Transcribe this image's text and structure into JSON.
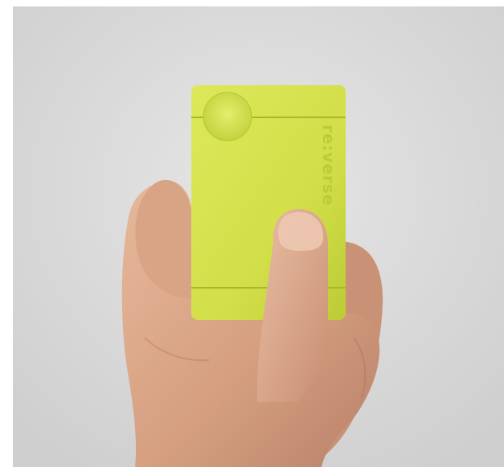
{
  "photo": {
    "subject": "product-photo-hand-holding-card-device",
    "device": {
      "brand_text": "re:verse",
      "color": "#d4e14a"
    },
    "background_color": "#d9d9d9",
    "skin_color": "#d9a486"
  }
}
